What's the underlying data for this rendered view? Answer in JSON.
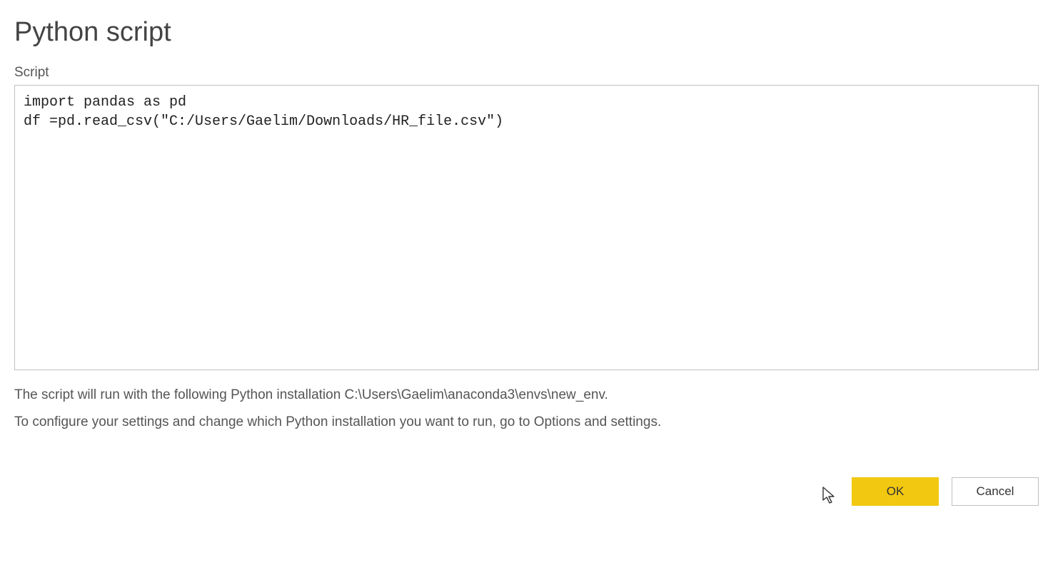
{
  "dialog": {
    "title": "Python script",
    "script_label": "Script",
    "script_value": "import pandas as pd\ndf =pd.read_csv(\"C:/Users/Gaelim/Downloads/HR_file.csv\")",
    "info_line1": "The script will run with the following Python installation C:\\Users\\Gaelim\\anaconda3\\envs\\new_env.",
    "info_line2": "To configure your settings and change which Python installation you want to run, go to Options and settings.",
    "ok_label": "OK",
    "cancel_label": "Cancel"
  }
}
